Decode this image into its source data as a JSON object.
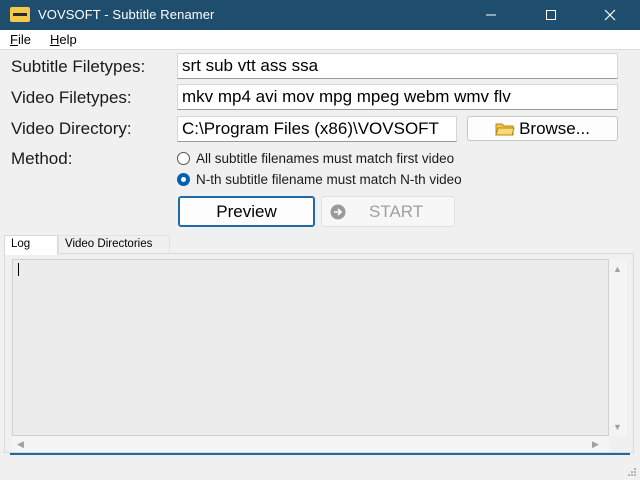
{
  "window": {
    "title": "VOVSOFT - Subtitle Renamer"
  },
  "menu": {
    "file_underline": "F",
    "file_rest": "ile",
    "help_underline": "H",
    "help_rest": "elp"
  },
  "form": {
    "subtitle_label": "Subtitle Filetypes:",
    "subtitle_value": "srt sub vtt ass ssa",
    "video_label": "Video Filetypes:",
    "video_value": "mkv mp4 avi mov mpg mpeg webm wmv flv",
    "directory_label": "Video Directory:",
    "directory_value": "C:\\Program Files (x86)\\VOVSOFT",
    "browse_label": "Browse...",
    "method_label": "Method:",
    "method_options": [
      {
        "label": "All subtitle filenames must match first video",
        "selected": false
      },
      {
        "label": "N-th subtitle filename must match N-th video",
        "selected": true
      }
    ]
  },
  "actions": {
    "preview_label": "Preview",
    "start_label": "START",
    "start_enabled": false
  },
  "tabs": [
    {
      "label": "Log",
      "active": true
    },
    {
      "label": "Video Directories",
      "active": false
    }
  ],
  "log": {
    "text": ""
  },
  "colors": {
    "titlebar": "#1e4d6e",
    "accent": "#005fb8",
    "focus_border": "#1f6aa5",
    "disabled_text": "#a0a0a0"
  },
  "icons": [
    "app-icon",
    "minimize-icon",
    "maximize-icon",
    "close-icon",
    "folder-icon",
    "arrow-right-circle-icon",
    "size-grip-icon"
  ]
}
